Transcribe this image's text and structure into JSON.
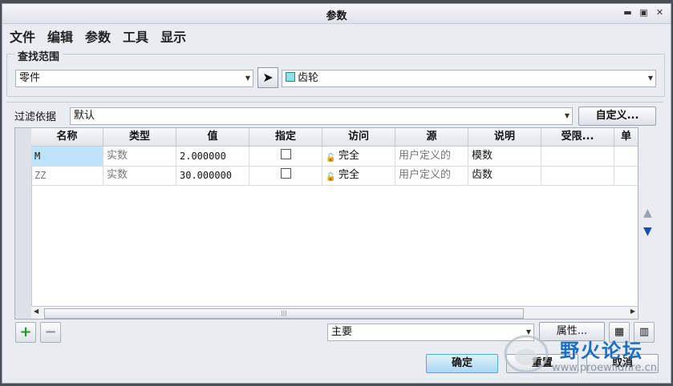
{
  "window": {
    "title": "参数"
  },
  "menu": [
    "文件",
    "编辑",
    "参数",
    "工具",
    "显示"
  ],
  "scope": {
    "title": "查找范围",
    "type_value": "零件",
    "object_value": "齿轮"
  },
  "filter": {
    "label": "过滤依据",
    "value": "默认",
    "customize_label": "自定义..."
  },
  "table": {
    "columns": [
      "名称",
      "类型",
      "值",
      "指定",
      "访问",
      "源",
      "说明",
      "受限...",
      "单"
    ],
    "rows": [
      {
        "name": "M",
        "type": "实数",
        "value": "2.000000",
        "access": "完全",
        "source": "用户定义的",
        "desc": "模数"
      },
      {
        "name": "ZZ",
        "type": "实数",
        "value": "30.000000",
        "access": "完全",
        "source": "用户定义的",
        "desc": "齿数"
      }
    ]
  },
  "bottom": {
    "add_symbol": "+",
    "remove_symbol": "−",
    "main_value": "主要",
    "properties_label": "属性..."
  },
  "footer": {
    "ok_label": "确定",
    "reset_label": "重置",
    "cancel_label": "取消"
  },
  "watermark": {
    "brand": "野火论坛",
    "url": "www.proewildfire.cn"
  }
}
